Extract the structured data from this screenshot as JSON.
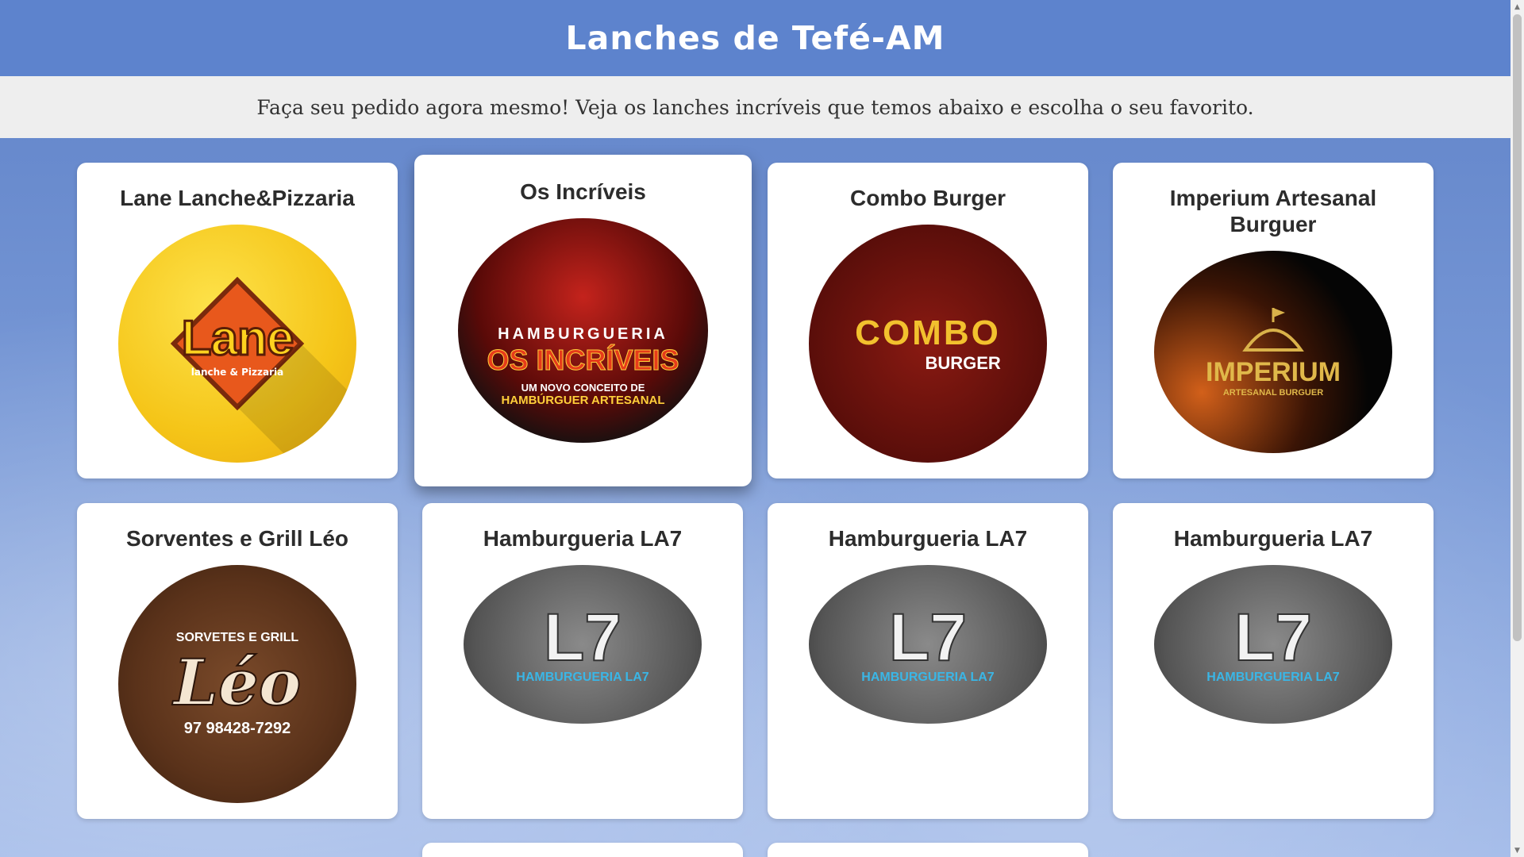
{
  "header": {
    "title": "Lanches de Tefé-AM"
  },
  "banner": {
    "text": "Faça seu pedido agora mesmo! Veja os lanches incríveis que temos abaixo e escolha o seu favorito."
  },
  "cards": [
    {
      "name": "Lane Lanche&Pizzaria",
      "logo_text": "Lane",
      "logo_sub": "lanche & Pizzaria"
    },
    {
      "name": "Os Incríveis",
      "logo_text": "HAMBURGUERIA",
      "logo_big": "OS INCRÍVEIS",
      "logo_sub": "UM NOVO CONCEITO DE",
      "logo_sub2": "HAMBÚRGUER ARTESANAL"
    },
    {
      "name": "Combo Burger",
      "logo_text": "COMBO",
      "logo_sub": "BURGER"
    },
    {
      "name": "Imperium Artesanal Burguer",
      "logo_text": "IMPERIUM",
      "logo_sub": "ARTESANAL BURGUER"
    },
    {
      "name": "Sorventes e Grill Léo",
      "logo_text": "Léo",
      "logo_sub": "SORVETES E GRILL",
      "logo_phone": "97 98428-7292"
    },
    {
      "name": "Hamburgueria LA7",
      "logo_text": "L7",
      "logo_sub": "HAMBURGUERIA LA7"
    },
    {
      "name": "Hamburgueria LA7",
      "logo_text": "L7",
      "logo_sub": "HAMBURGUERIA LA7"
    },
    {
      "name": "Hamburgueria LA7",
      "logo_text": "L7",
      "logo_sub": "HAMBURGUERIA LA7"
    }
  ],
  "colors": {
    "header": "#5d83cd",
    "banner": "#eeeeee",
    "card": "#ffffff"
  }
}
